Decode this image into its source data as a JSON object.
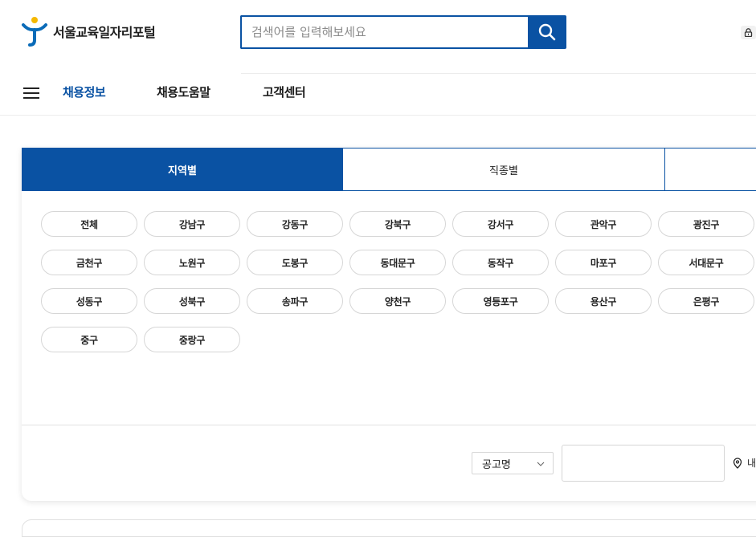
{
  "header": {
    "logo_text": "서울교육일자리포털",
    "search_placeholder": "검색어를 입력해보세요"
  },
  "nav": {
    "items": [
      "채용정보",
      "채용도움말",
      "고객센터"
    ]
  },
  "tabs": [
    "지역별",
    "직종별",
    ""
  ],
  "districts": [
    "전체",
    "강남구",
    "강동구",
    "강북구",
    "강서구",
    "관악구",
    "광진구",
    "금천구",
    "노원구",
    "도봉구",
    "동대문구",
    "동작구",
    "마포구",
    "서대문구",
    "성동구",
    "성북구",
    "송파구",
    "양천구",
    "영등포구",
    "용산구",
    "은평구",
    "중구",
    "중랑구"
  ],
  "filter": {
    "select_value": "공고명",
    "location_label": "내"
  },
  "colors": {
    "brand": "#0a52a3",
    "logo_blue": "#0a6bb8",
    "logo_yellow": "#f5b800"
  },
  "icons": {
    "search": "search-icon",
    "lock": "lock-icon",
    "menu": "hamburger-menu-icon",
    "chevron": "chevron-down-icon",
    "location": "map-pin-icon"
  }
}
